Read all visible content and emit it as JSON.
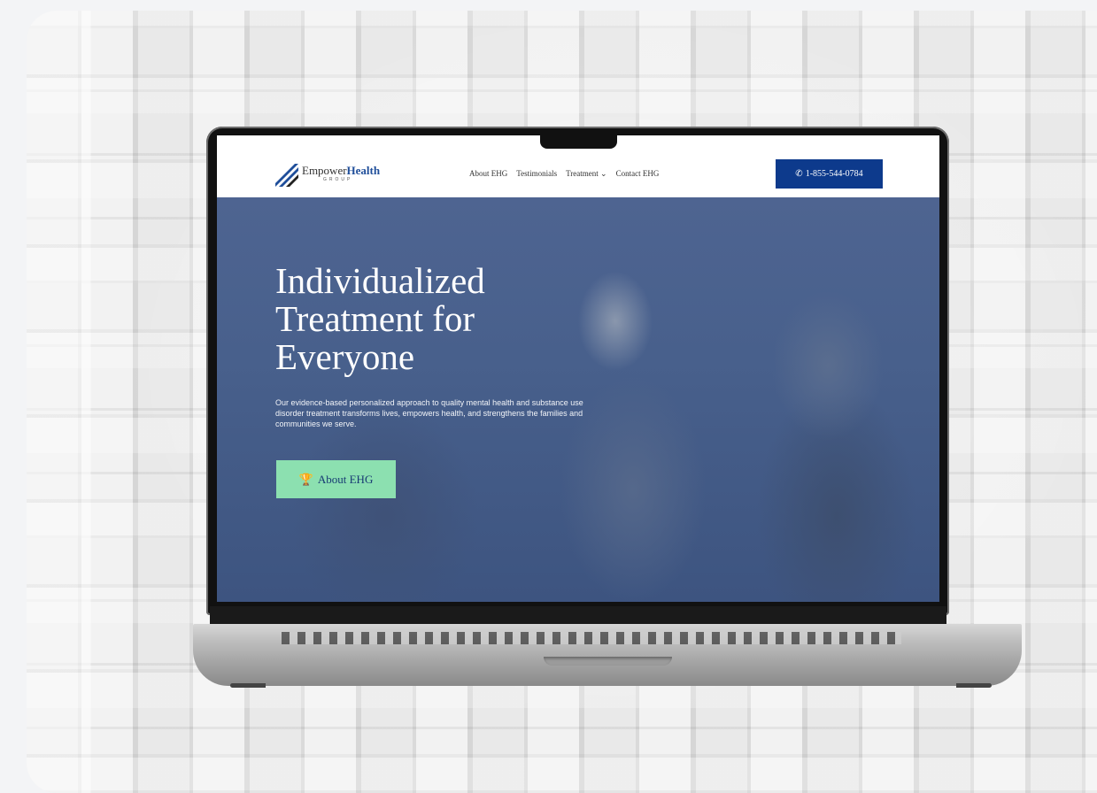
{
  "brand": {
    "name_part1": "Empower",
    "name_part2": "Health",
    "sub": "GROUP",
    "accent": "#1f4e9a"
  },
  "nav": {
    "items": [
      "About EHG",
      "Testimonials",
      "Treatment",
      "Contact EHG"
    ],
    "dropdown_icon": "chevron-down-icon"
  },
  "phone": {
    "icon": "phone-icon",
    "label": "1-855-544-0784",
    "color": "#0d3a8c"
  },
  "hero": {
    "title_line1": "Individualized",
    "title_line2": "Treatment for",
    "title_line3": "Everyone",
    "text": "Our evidence-based personalized approach to quality mental health and substance use disorder treatment transforms lives, empowers health, and strengthens the families and communities we serve.",
    "button_icon": "trophy-icon",
    "button_label": "About EHG",
    "button_color": "#8ce0b0"
  }
}
